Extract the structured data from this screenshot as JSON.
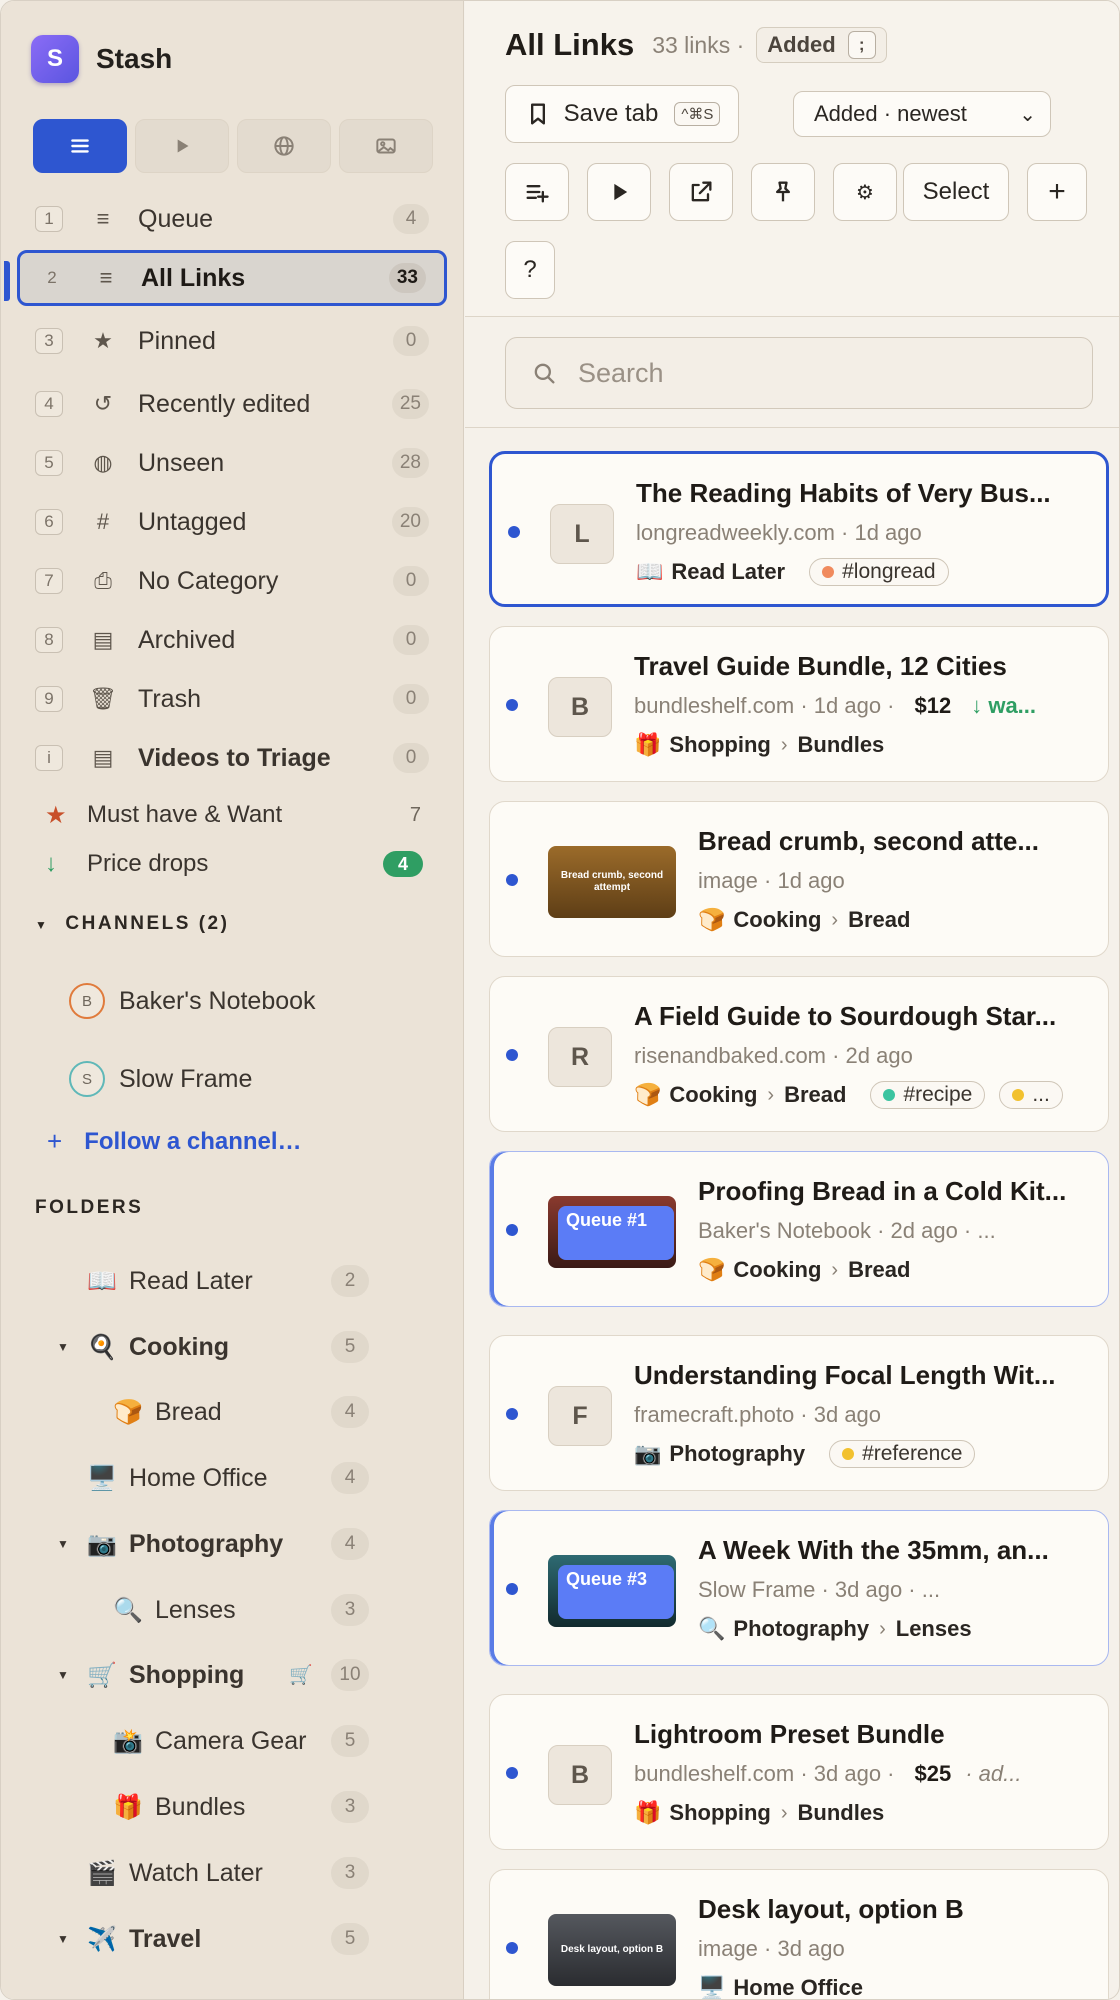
{
  "app": {
    "name": "Stash",
    "logo_letter": "S"
  },
  "mode_tabs": [
    {
      "name": "list",
      "icon": "list-icon",
      "active": true
    },
    {
      "name": "play",
      "icon": "play-icon",
      "active": false
    },
    {
      "name": "globe",
      "icon": "globe-icon",
      "active": false
    },
    {
      "name": "image",
      "icon": "image-icon",
      "active": false
    }
  ],
  "nav": [
    {
      "key": "1",
      "icon": "≡",
      "label": "Queue",
      "count": "4"
    },
    {
      "key": "2",
      "icon": "≡",
      "label": "All Links",
      "count": "33"
    },
    {
      "key": "3",
      "icon": "★",
      "label": "Pinned",
      "count": "0"
    },
    {
      "key": "4",
      "icon": "↺",
      "label": "Recently edited",
      "count": "25"
    },
    {
      "key": "5",
      "icon": "◍",
      "label": "Unseen",
      "count": "28"
    },
    {
      "key": "6",
      "icon": "#",
      "label": "Untagged",
      "count": "20"
    },
    {
      "key": "7",
      "icon": "⎙",
      "label": "No Category",
      "count": "0"
    },
    {
      "key": "8",
      "icon": "▤",
      "label": "Archived",
      "count": "0"
    },
    {
      "key": "9",
      "icon": "🗑",
      "label": "Trash",
      "count": "0"
    },
    {
      "key": "i",
      "icon": "▤",
      "label": "Videos to Triage",
      "count": "0"
    }
  ],
  "smart_lists": [
    {
      "icon": "★",
      "label": "Must have & Want",
      "count": "7",
      "color": "#c8502a"
    },
    {
      "icon": "↓",
      "label": "Price drops",
      "count": "4",
      "color": "#2f9e63"
    }
  ],
  "channels": {
    "heading": "CHANNELS (2)",
    "items": [
      {
        "letter": "B",
        "label": "Baker's Notebook",
        "color": "#e07b3c"
      },
      {
        "letter": "S",
        "label": "Slow Frame",
        "color": "#5fb8b8"
      }
    ],
    "follow_label": "Follow a channel…"
  },
  "folders": {
    "heading": "FOLDERS",
    "items": [
      {
        "emoji": "📖",
        "label": "Read Later",
        "count": "2"
      },
      {
        "emoji": "🍳",
        "label": "Cooking",
        "count": "5"
      },
      {
        "emoji": "🍞",
        "label": "Bread",
        "count": "4"
      },
      {
        "emoji": "🖥️",
        "label": "Home Office",
        "count": "4"
      },
      {
        "emoji": "📷",
        "label": "Photography",
        "count": "4"
      },
      {
        "emoji": "🔍",
        "label": "Lenses",
        "count": "3"
      },
      {
        "emoji": "🛒",
        "label": "Shopping",
        "count": "10",
        "extra": "🛒"
      },
      {
        "emoji": "📸",
        "label": "Camera Gear",
        "count": "5"
      },
      {
        "emoji": "🎁",
        "label": "Bundles",
        "count": "3"
      },
      {
        "emoji": "🎬",
        "label": "Watch Later",
        "count": "3"
      },
      {
        "emoji": "✈️",
        "label": "Travel",
        "count": "5"
      }
    ]
  },
  "header": {
    "title": "All Links",
    "subtitle": "33 links ·",
    "sort_chip": "Added",
    "sort_chip_key": ";",
    "save_tab_label": "Save tab",
    "save_tab_shortcut": "^⌘S",
    "sort_select": "Added · newest",
    "select_label": "Select",
    "help_label": "?",
    "plus_label": "+",
    "gear_label": "⚙"
  },
  "search": {
    "placeholder": "Search"
  },
  "cards": [
    {
      "title": "The Reading Habits of Very Bus...",
      "meta": "longreadweekly.com · 1d ago",
      "letter": "L",
      "category": [
        {
          "emoji": "📖",
          "label": "Read Later"
        }
      ],
      "tags": [
        {
          "label": "#longread",
          "color": "#f08a5d"
        }
      ]
    },
    {
      "title": "Travel Guide Bundle, 12 Cities",
      "meta": "bundleshelf.com · 1d ago ·",
      "price": "$12",
      "drop": "↓ wa...",
      "letter": "B",
      "category": [
        {
          "emoji": "🎁",
          "label": "Shopping"
        },
        {
          "label": "Bundles"
        }
      ]
    },
    {
      "title": "Bread crumb, second atte...",
      "meta": "image · 1d ago",
      "thumb_text": "Bread crumb, second attempt",
      "category": [
        {
          "emoji": "🍞",
          "label": "Cooking"
        },
        {
          "label": "Bread"
        }
      ]
    },
    {
      "title": "A Field Guide to Sourdough Star...",
      "meta": "risenandbaked.com · 2d ago",
      "letter": "R",
      "category": [
        {
          "emoji": "🍞",
          "label": "Cooking"
        },
        {
          "label": "Bread"
        }
      ],
      "tags": [
        {
          "label": "#recipe",
          "color": "#3bc4a0"
        },
        {
          "label": "...",
          "color": "#f2c12e"
        }
      ]
    },
    {
      "title": "Proofing Bread in a Cold Kit...",
      "meta": "Baker's Notebook · 2d ago · ...",
      "queue": "Queue #1",
      "category": [
        {
          "emoji": "🍞",
          "label": "Cooking"
        },
        {
          "label": "Bread"
        }
      ]
    },
    {
      "title": "Understanding Focal Length Wit...",
      "meta": "framecraft.photo · 3d ago",
      "letter": "F",
      "category": [
        {
          "emoji": "📷",
          "label": "Photography"
        }
      ],
      "tags": [
        {
          "label": "#reference",
          "color": "#f2c12e"
        }
      ]
    },
    {
      "title": "A Week With the 35mm, an...",
      "meta": "Slow Frame · 3d ago · ...",
      "queue": "Queue #3",
      "category": [
        {
          "emoji": "🔍",
          "label": "Photography"
        },
        {
          "label": "Lenses"
        }
      ]
    },
    {
      "title": "Lightroom Preset Bundle",
      "meta": "bundleshelf.com · 3d ago ·",
      "price": "$25",
      "note": "·  ad...",
      "letter": "B",
      "category": [
        {
          "emoji": "🎁",
          "label": "Shopping"
        },
        {
          "label": "Bundles"
        }
      ]
    },
    {
      "title": "Desk layout, option B",
      "meta": "image · 3d ago",
      "thumb_text": "Desk layout, option B",
      "category": [
        {
          "emoji": "🖥️",
          "label": "Home Office"
        }
      ]
    }
  ]
}
